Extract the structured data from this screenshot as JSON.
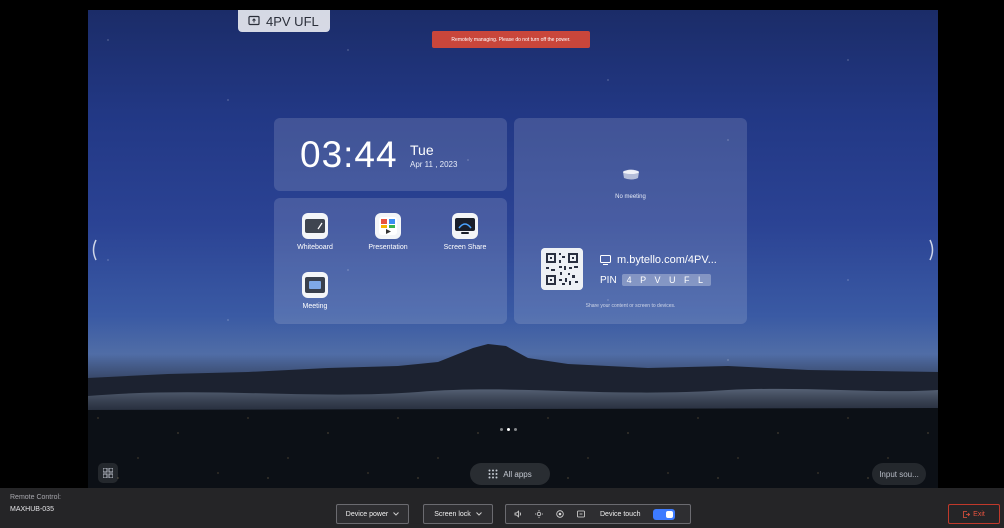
{
  "device_tab": {
    "label": "4PV UFL",
    "icon": "screen-share-icon"
  },
  "banner": {
    "text": "Remotely managing. Please do not turn off the power."
  },
  "clock": {
    "time": "03:44",
    "day": "Tue",
    "date": "Apr 11 , 2023"
  },
  "apps": [
    {
      "label": "Whiteboard",
      "icon": "whiteboard-icon"
    },
    {
      "label": "Presentation",
      "icon": "presentation-icon"
    },
    {
      "label": "Screen Share",
      "icon": "screen-share-icon"
    },
    {
      "label": "Meeting",
      "icon": "meeting-icon"
    }
  ],
  "meeting": {
    "status": "No meeting",
    "url": "m.bytello.com/4PV...",
    "pin_label": "PIN",
    "pin": "4 P V U F L",
    "share_text": "Share your content or screen to devices."
  },
  "launcher": {
    "all_apps": "All apps",
    "input_source": "Input sou..."
  },
  "bottom_bar": {
    "remote_label": "Remote Control:",
    "device_name": "MAXHUB-035",
    "device_power": "Device power",
    "screen_lock": "Screen lock",
    "device_touch": "Device touch",
    "device_touch_on": true,
    "exit": "Exit"
  },
  "colors": {
    "banner": "#c9463b",
    "toggle": "#3d7bff",
    "exit": "#e5533f"
  }
}
